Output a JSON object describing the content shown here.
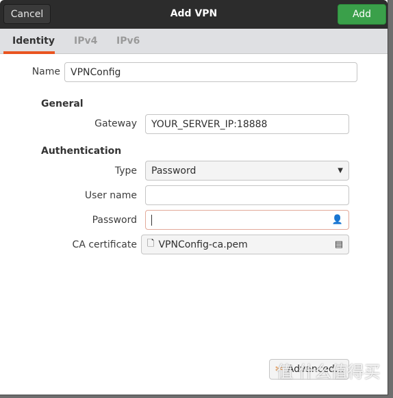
{
  "header": {
    "cancel": "Cancel",
    "title": "Add VPN",
    "add": "Add"
  },
  "tabs": [
    {
      "label": "Identity",
      "active": true
    },
    {
      "label": "IPv4"
    },
    {
      "label": "IPv6"
    }
  ],
  "name": {
    "label": "Name",
    "value": "VPNConfig"
  },
  "general": {
    "heading": "General",
    "gateway_label": "Gateway",
    "gateway_value": "YOUR_SERVER_IP:18888"
  },
  "auth": {
    "heading": "Authentication",
    "type_label": "Type",
    "type_value": "Password",
    "username_label": "User name",
    "username_value": "",
    "password_label": "Password",
    "password_value": "",
    "ca_label": "CA certificate",
    "ca_value": "VPNConfig-ca.pem"
  },
  "advanced": "Advanced...",
  "watermark": "值 什么值得买",
  "colors": {
    "accent": "#e95420",
    "add_button": "#3aa04a",
    "header": "#2c2c2c"
  }
}
